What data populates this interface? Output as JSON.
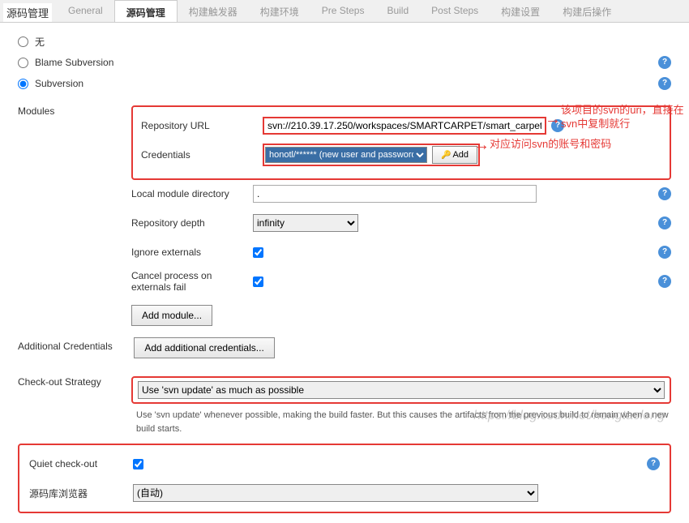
{
  "page_title": "源码管理",
  "tabs": [
    "General",
    "源码管理",
    "构建触发器",
    "构建环境",
    "Pre Steps",
    "Build",
    "Post Steps",
    "构建设置",
    "构建后操作"
  ],
  "active_tab": 1,
  "radios": {
    "none": "无",
    "blame": "Blame Subversion",
    "svn": "Subversion"
  },
  "modules_label": "Modules",
  "repo": {
    "label": "Repository URL",
    "value": "svn://210.39.17.250/workspaces/SMARTCARPET/smart_carpet"
  },
  "cred": {
    "label": "Credentials",
    "selected": "honotl/****** (new user and password)",
    "add_btn": "Add"
  },
  "local_dir": {
    "label": "Local module directory",
    "value": "."
  },
  "depth": {
    "label": "Repository depth",
    "value": "infinity"
  },
  "ignore_ext": {
    "label": "Ignore externals"
  },
  "cancel_ext": {
    "label": "Cancel process on externals fail"
  },
  "add_module_btn": "Add module...",
  "additional_cred": {
    "label": "Additional Credentials",
    "btn": "Add additional credentials..."
  },
  "strategy": {
    "label": "Check-out Strategy",
    "value": "Use 'svn update' as much as possible",
    "desc": "Use 'svn update' whenever possible, making the build faster. But this causes the artifacts from the previous build to remain when a new build starts."
  },
  "quiet": {
    "label": "Quiet check-out"
  },
  "browser": {
    "label": "源码库浏览器",
    "value": "(自动)"
  },
  "annotations": {
    "a1": "该项目的svn的uri，直接在svn中复制就行",
    "a2": "对应访问svn的账号和密码"
  },
  "watermark": "https://blog.csdn.net/hongtaolong"
}
